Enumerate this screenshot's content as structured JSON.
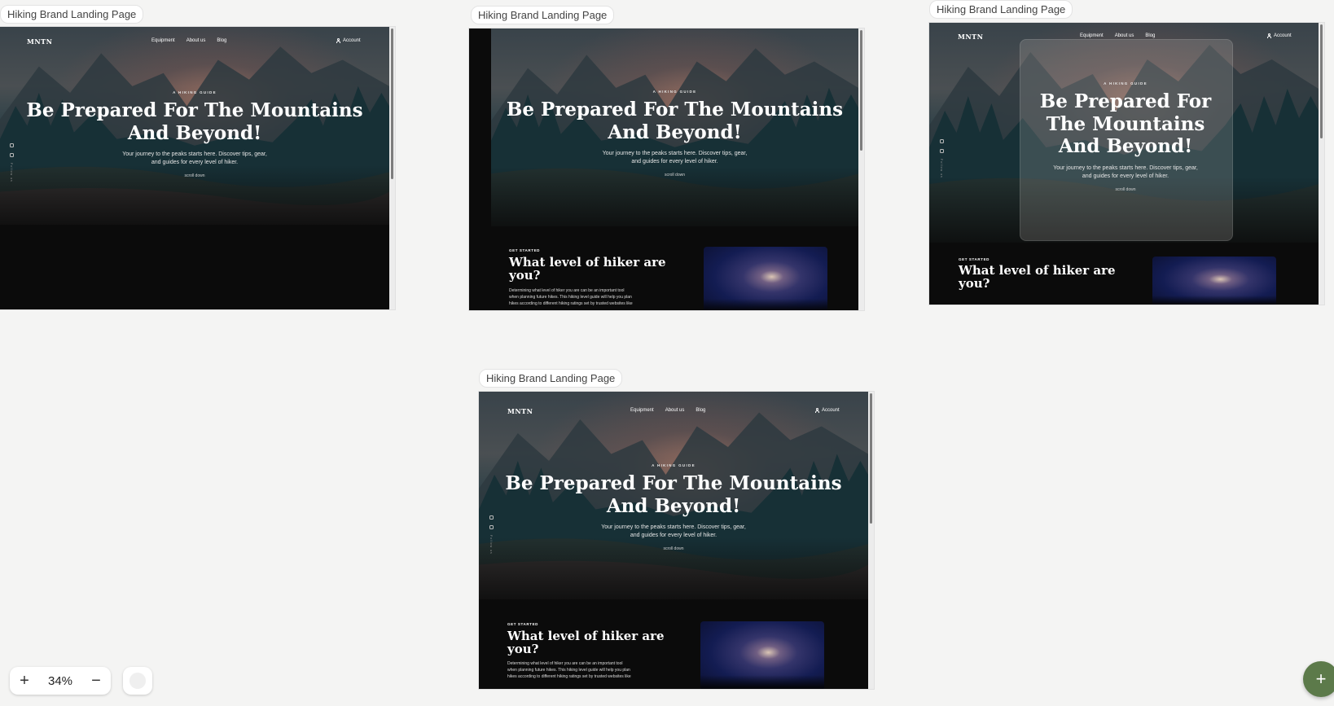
{
  "canvas": {
    "zoom": "34%",
    "zoom_in": "+",
    "zoom_out": "−",
    "add": "+"
  },
  "site": {
    "logo": "MNTN",
    "nav": [
      "Equipment",
      "About us",
      "Blog"
    ],
    "account": "Account",
    "eyebrow": "A HIKING GUIDE",
    "headline": "Be Prepared For The Mountains And Beyond!",
    "sub_line1": "Your journey to the peaks starts here. Discover tips, gear,",
    "sub_line2": "and guides for every level of hiker.",
    "scroll": "scroll down",
    "social_text": "Follow us",
    "section_eyebrow": "GET STARTED",
    "section_title_line1": "What level of hiker are",
    "section_title_line2": "you?",
    "section_para_line1": "Determining what level of hiker you are can be an important tool",
    "section_para_line2": "when planning future hikes. This hiking level guide will help you plan",
    "section_para_line3": "hikes according to different hiking ratings set by trusted websites like"
  },
  "frames": [
    {
      "label": "Hiking Brand Landing Page"
    },
    {
      "label": "Hiking Brand Landing Page"
    },
    {
      "label": "Hiking Brand Landing Page"
    },
    {
      "label": "Hiking Brand Landing Page"
    }
  ]
}
